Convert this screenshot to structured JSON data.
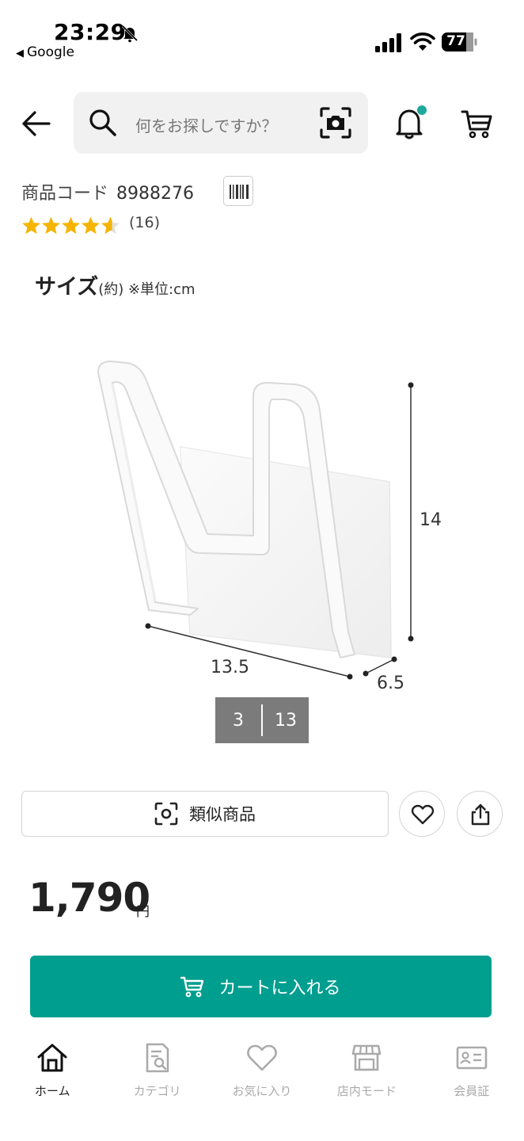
{
  "status_bar": {
    "time": "23:29",
    "back_app": "Google",
    "battery": "77"
  },
  "search": {
    "placeholder": "何をお探しですか？"
  },
  "product": {
    "code_label": "商品コード",
    "code": "8988276",
    "rating": 4.5,
    "review_count": "(16)"
  },
  "image": {
    "size_title": "サイズ",
    "size_sub": "(約) ※単位:cm",
    "dim_height": "14",
    "dim_width": "13.5",
    "dim_depth": "6.5",
    "page_current": "3",
    "page_total": "13"
  },
  "actions": {
    "similar_label": "類似商品"
  },
  "price": {
    "value": "1,790",
    "unit": "円"
  },
  "cart": {
    "label": "カートに入れる",
    "color": "#009e8f"
  },
  "nav": {
    "items": [
      {
        "label": "ホーム",
        "icon": "home-icon"
      },
      {
        "label": "カテゴリ",
        "icon": "category-icon"
      },
      {
        "label": "お気に入り",
        "icon": "heart-icon"
      },
      {
        "label": "店内モード",
        "icon": "store-icon"
      },
      {
        "label": "会員証",
        "icon": "member-card-icon"
      }
    ]
  }
}
